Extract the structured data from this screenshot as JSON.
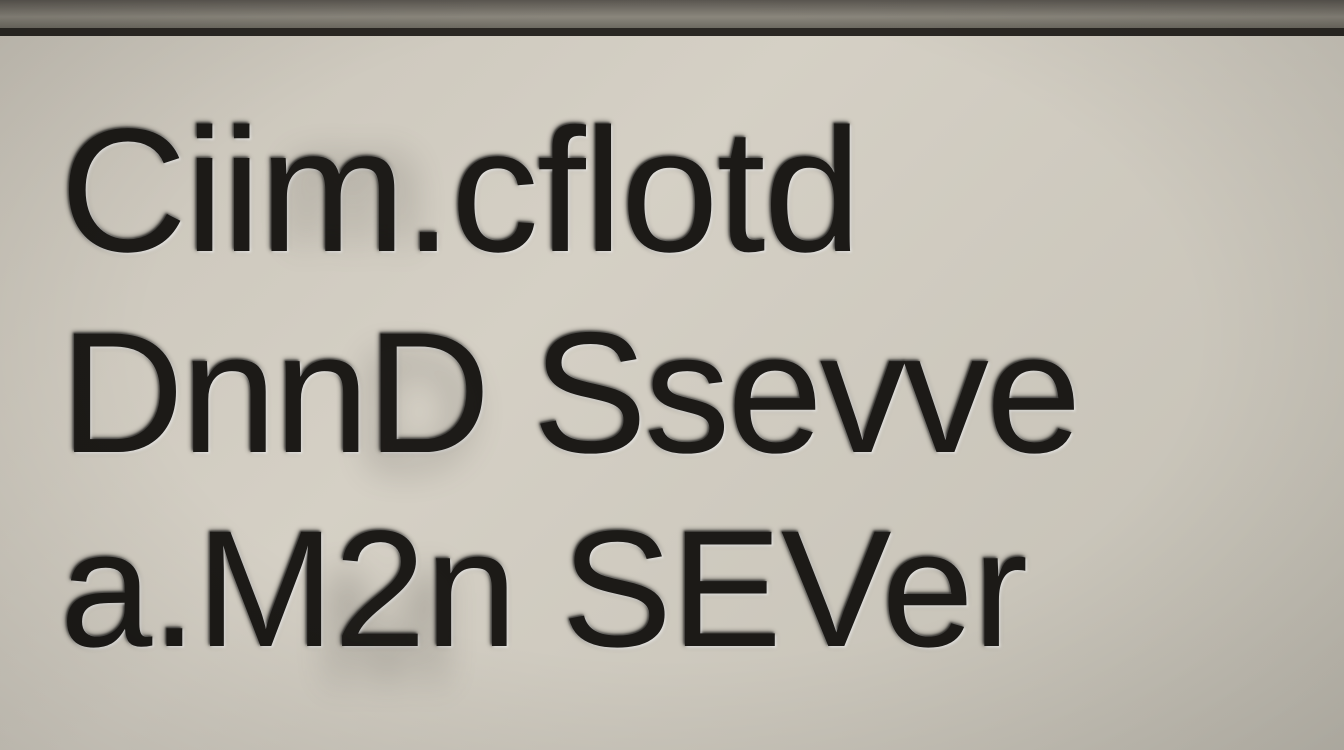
{
  "lines": {
    "l1": "Ciim.cflotd",
    "l2": "DnnD Ssevve",
    "l3": "a.M2n SEVer"
  }
}
